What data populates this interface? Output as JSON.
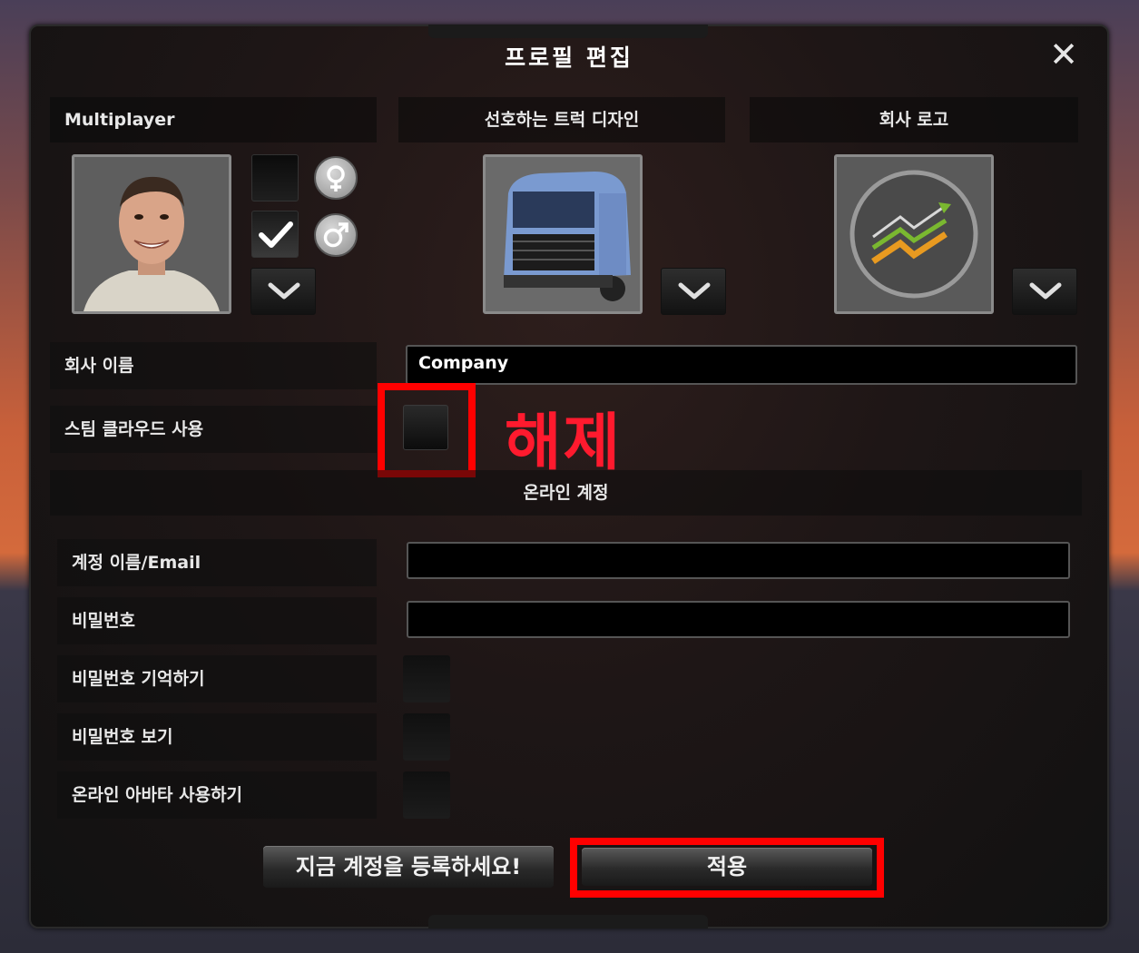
{
  "dialog": {
    "title": "프로필 편집",
    "close_icon": "close-icon"
  },
  "headers": {
    "multiplayer": "Multiplayer",
    "truck_design": "선호하는 트럭 디자인",
    "company_logo": "회사 로고"
  },
  "fields": {
    "company_name_label": "회사 이름",
    "company_name_value": "Company",
    "steam_cloud_label": "스팀 클라우드 사용"
  },
  "annotation": {
    "text": "해제",
    "color": "#ff0000"
  },
  "online_account": {
    "section_title": "온라인 계정",
    "username_label": "계정 이름/Email",
    "username_value": "",
    "password_label": "비밀번호",
    "password_value": "",
    "remember_label": "비밀번호 기억하기",
    "show_password_label": "비밀번호 보기",
    "online_avatar_label": "온라인 아바타 사용하기"
  },
  "buttons": {
    "register": "지금 계정을 등록하세요!",
    "apply": "적용"
  },
  "gender": {
    "female_icon": "female-icon",
    "male_icon": "male-icon",
    "selected": "male"
  },
  "colors": {
    "accent_red": "#ff0000",
    "panel": "#1e1616"
  }
}
